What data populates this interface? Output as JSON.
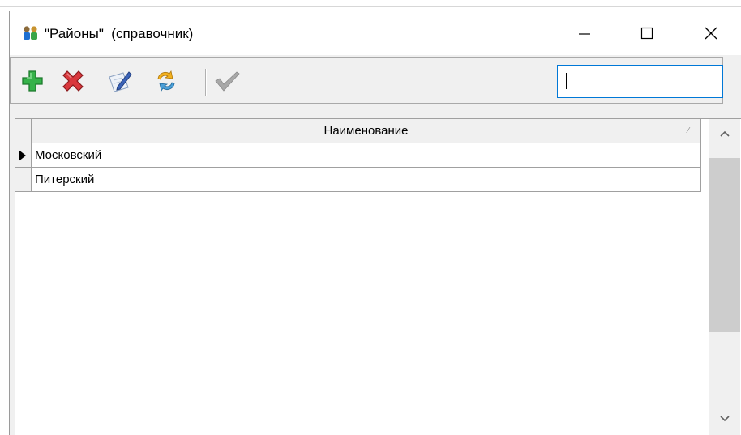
{
  "window": {
    "title": "\"Районы\"  (справочник)"
  },
  "toolbar": {
    "buttons": [
      {
        "name": "add",
        "icon": "plus-icon"
      },
      {
        "name": "delete",
        "icon": "x-icon"
      },
      {
        "name": "edit",
        "icon": "pen-icon"
      },
      {
        "name": "refresh",
        "icon": "refresh-icon"
      },
      {
        "name": "select",
        "icon": "check-icon"
      }
    ],
    "search_value": ""
  },
  "grid": {
    "columns": [
      "Наименование"
    ],
    "rows": [
      {
        "name": "Московский",
        "current": true
      },
      {
        "name": "Питерский",
        "current": false
      }
    ]
  },
  "scrollbar": {
    "up_label": "^",
    "down_label": "v"
  },
  "colors": {
    "accent": "#0078d7",
    "add_green": "#2ea44f",
    "delete_red": "#d43a3a"
  }
}
